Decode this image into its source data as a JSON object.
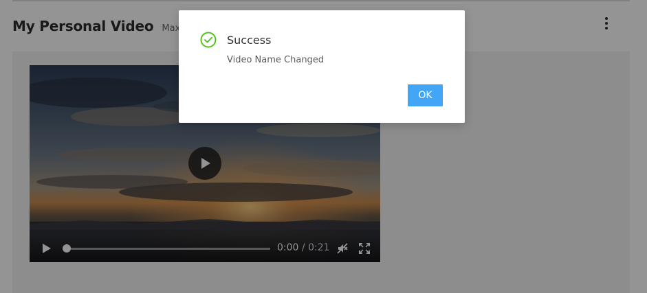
{
  "page": {
    "title": "My Personal Video",
    "subtitle": "Max File S",
    "more_icon": "vertical-ellipsis-icon"
  },
  "player": {
    "current_time": "0:00",
    "separator": "/",
    "duration": "0:21",
    "progress": 0,
    "muted": true,
    "icons": {
      "play": "play-icon",
      "mute": "volume-muted-icon",
      "fullscreen": "fullscreen-icon"
    }
  },
  "dialog": {
    "title": "Success",
    "message": "Video Name Changed",
    "ok_label": "OK",
    "icon": "check-circle-icon",
    "colors": {
      "success": "#52c41a",
      "primary": "#42a5f5"
    }
  }
}
